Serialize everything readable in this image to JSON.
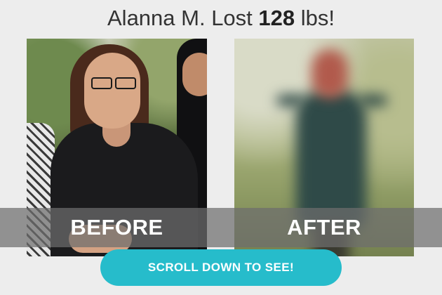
{
  "headline": {
    "prefix": "Alanna M. Lost ",
    "amount": "128",
    "suffix": " lbs!"
  },
  "labels": {
    "before": "BEFORE",
    "after": "AFTER"
  },
  "cta": {
    "label": "SCROLL DOWN TO SEE!"
  },
  "colors": {
    "cta_background": "#26bccb",
    "label_band": "rgba(110,110,110,0.72)"
  }
}
